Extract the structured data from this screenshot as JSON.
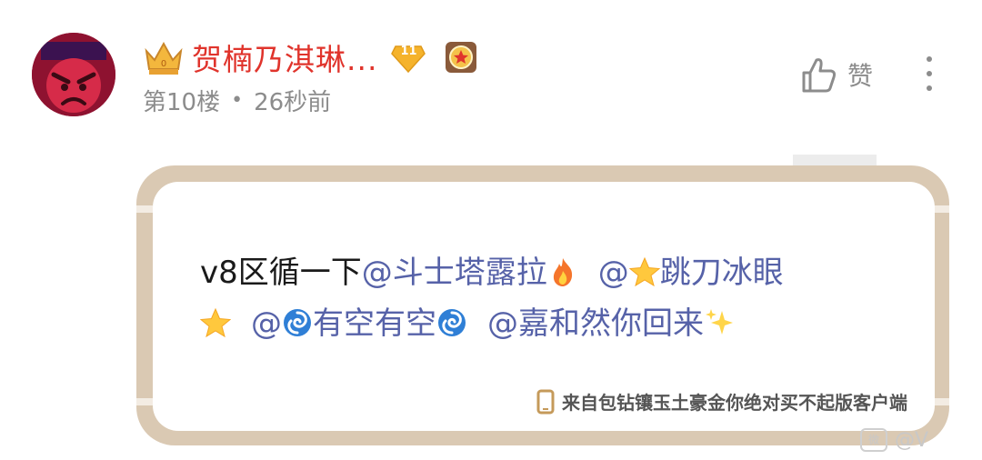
{
  "post": {
    "username": "贺楠乃淇琳...",
    "level": "11",
    "floor": "第10楼",
    "separator": "•",
    "time": "26秒前",
    "like_label": "赞"
  },
  "comment": {
    "text_prefix": "v8区循一下",
    "mentions": [
      "@斗士塔露拉",
      "@",
      "跳刀冰眼",
      "@",
      "有空有空",
      "@嘉和然你回来"
    ],
    "source": "来自包钻镶玉土豪金你绝对买不起版客户端"
  },
  "icons": [
    "crown-icon",
    "level-diamond-icon",
    "medal-icon",
    "thumbs-up-icon",
    "more-vertical-icon",
    "fire-emoji",
    "star-emoji",
    "cyclone-emoji",
    "sparkles-emoji",
    "phone-icon"
  ],
  "watermark": {
    "text": "@V"
  },
  "colors": {
    "username": "#e0342c",
    "mention": "#5662a8",
    "meta": "#8c8c8c",
    "frame": "#dac9b3"
  }
}
